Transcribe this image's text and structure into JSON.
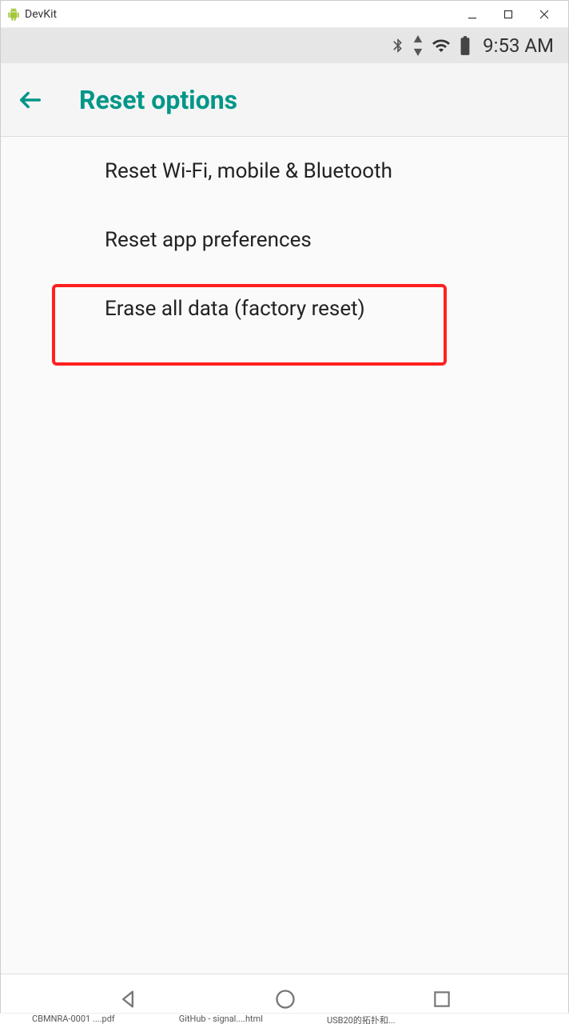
{
  "window": {
    "title": "DevKit"
  },
  "statusbar": {
    "time": "9:53 AM"
  },
  "header": {
    "title": "Reset options"
  },
  "options": [
    {
      "label": "Reset Wi-Fi, mobile & Bluetooth"
    },
    {
      "label": "Reset app preferences"
    },
    {
      "label": "Erase all data (factory reset)"
    }
  ],
  "taskbar": {
    "item0": "CBMNRA-0001 ....pdf",
    "item1": "GitHub - signal....html",
    "item2": "USB20的拓扑和..."
  }
}
